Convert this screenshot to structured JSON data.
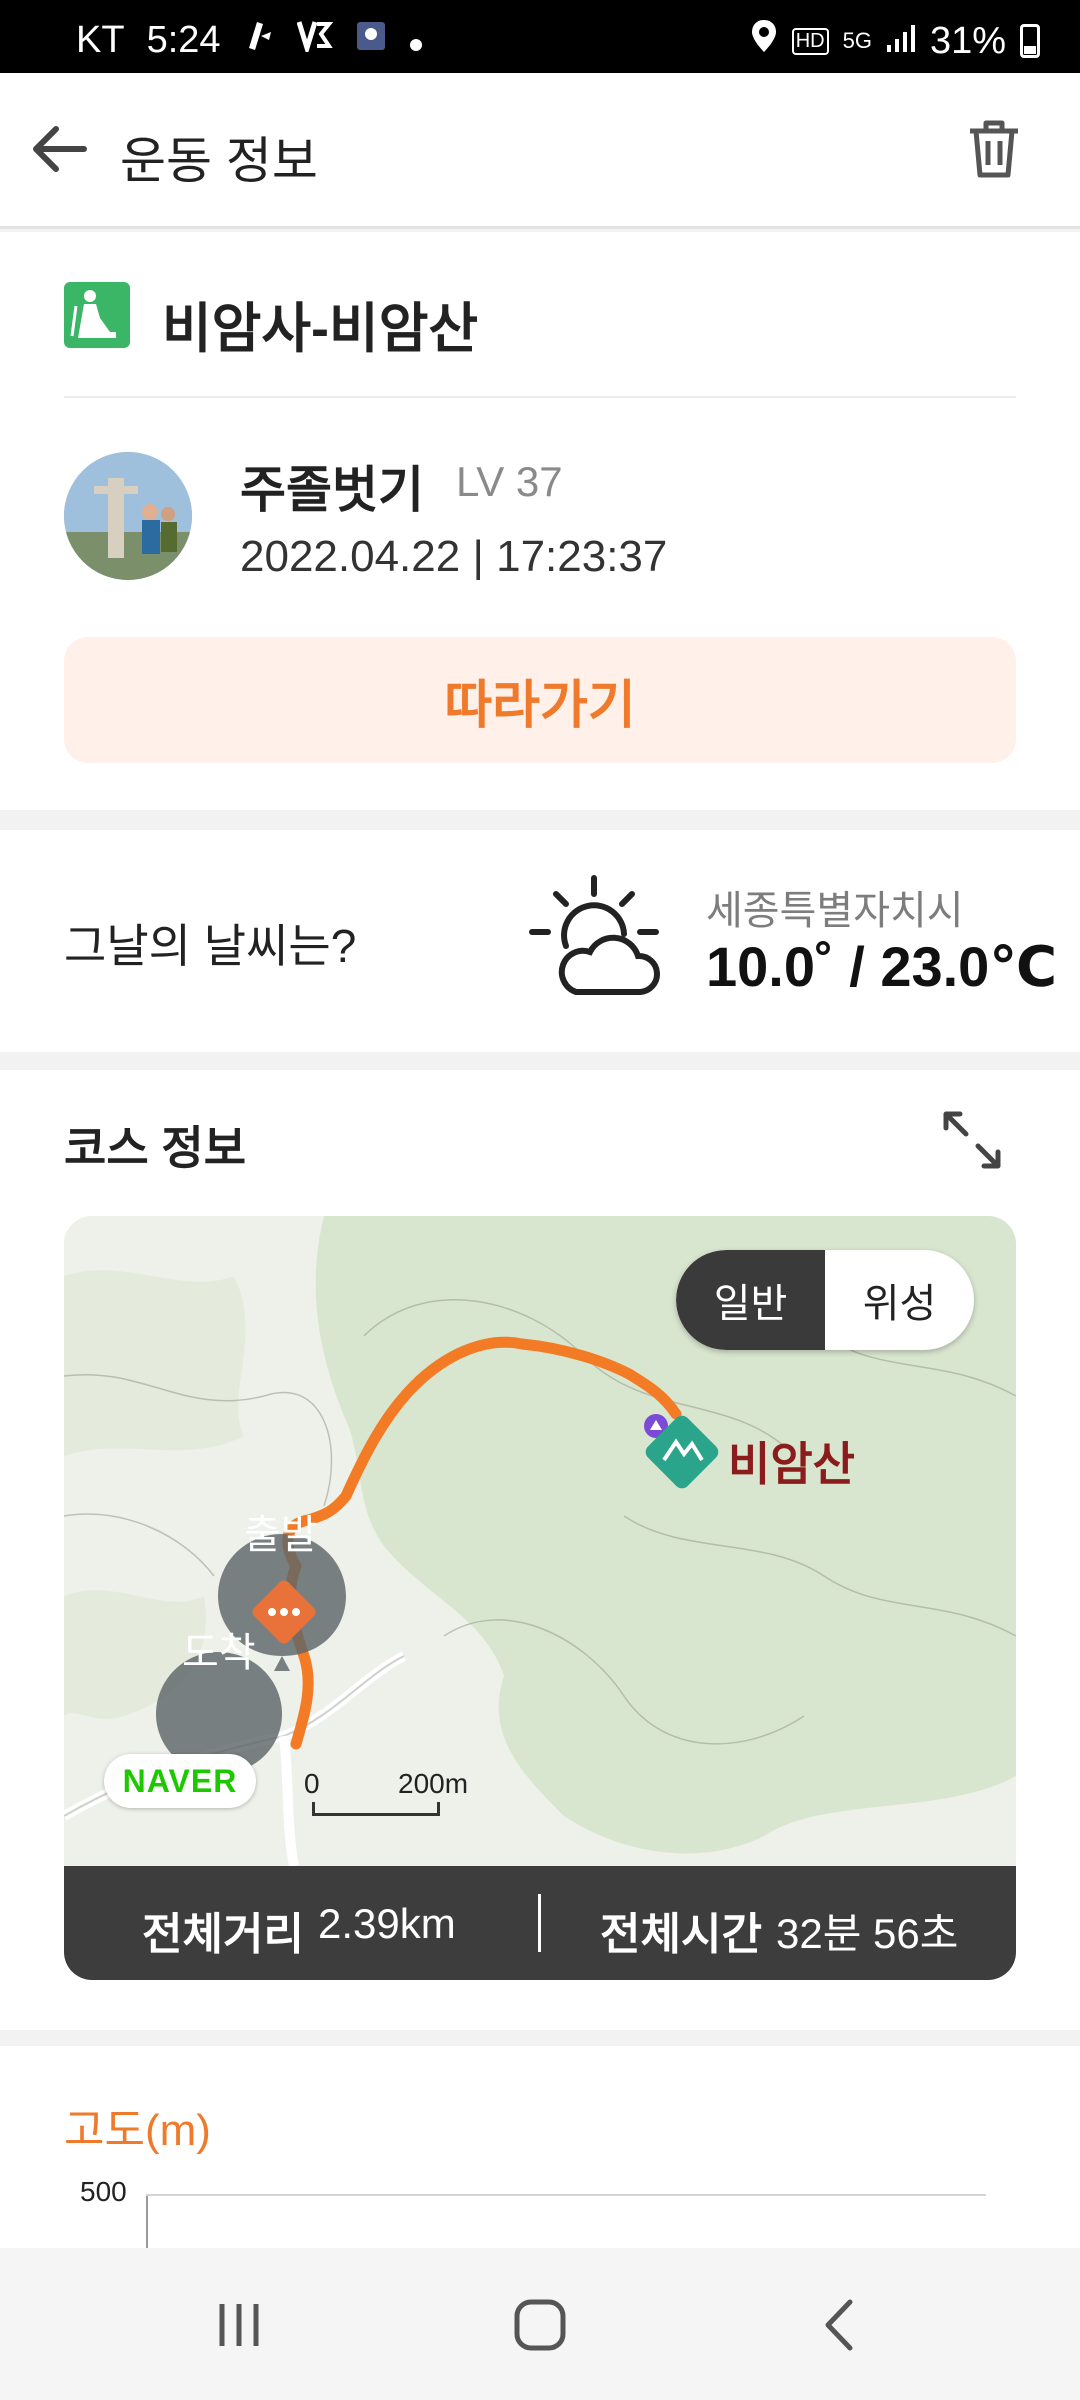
{
  "status_bar": {
    "carrier": "KT",
    "time": "5:24",
    "battery": "31%",
    "hd": "HD",
    "net": "5G"
  },
  "header": {
    "title": "운동 정보"
  },
  "activity": {
    "course_name": "비암사-비암산",
    "user_name": "주졸벗기",
    "level": "LV 37",
    "datetime": "2022.04.22 | 17:23:37",
    "follow_label": "따라가기"
  },
  "weather": {
    "question": "그날의 날씨는?",
    "location": "세종특별자치시",
    "temperature": "10.0˚ / 23.0℃"
  },
  "course": {
    "heading": "코스 정보",
    "map_mode_normal": "일반",
    "map_mode_satellite": "위성",
    "peak_label": "비암산",
    "start_label": "출발",
    "end_label": "도착",
    "map_brand": "NAVER",
    "scale_zero": "0",
    "scale_distance": "200m",
    "total_distance_label": "전체거리",
    "total_distance": "2.39km",
    "total_time_label": "전체시간",
    "total_time": "32분 56초"
  },
  "elevation": {
    "title": "고도(m)",
    "tick_top": "500"
  },
  "colors": {
    "accent": "#ef7a2c",
    "route": "#f47b25",
    "activity_green": "#3bb566",
    "summary_bg": "#3d3d3d"
  }
}
